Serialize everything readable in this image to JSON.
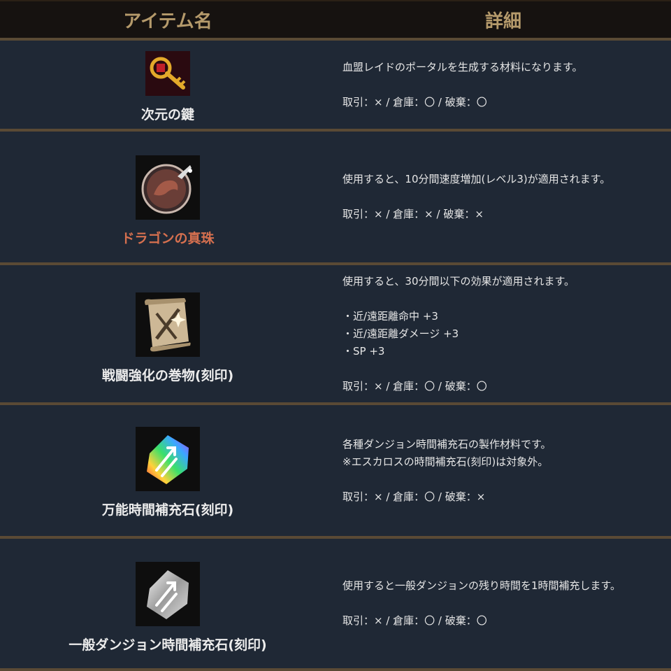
{
  "header": {
    "name_col": "アイテム名",
    "detail_col": "詳細"
  },
  "items": [
    {
      "name": "次元の鍵",
      "icon": "key-icon",
      "lines": [
        "血盟レイドのポータルを生成する材料になります。"
      ],
      "trade": "取引：× / 倉庫：〇 / 破棄：〇"
    },
    {
      "name": "ドラゴンの真珠",
      "icon": "dragon-pearl-icon",
      "name_color": "#d6704f",
      "lines": [
        "使用すると、10分間速度増加(レベル3)が適用されます。"
      ],
      "trade": "取引：× / 倉庫：× / 破棄：×"
    },
    {
      "name": "戦闘強化の巻物(刻印)",
      "icon": "scroll-icon",
      "lines": [
        "使用すると、30分間以下の効果が適用されます。"
      ],
      "effects": [
        "・近/遠距離命中 +3",
        "・近/遠距離ダメージ +3",
        "・SP +3"
      ],
      "trade": "取引：× / 倉庫：〇 / 破棄：〇"
    },
    {
      "name": "万能時間補充石(刻印)",
      "icon": "rainbow-crystal-icon",
      "lines": [
        "各種ダンジョン時間補充石の製作材料です。",
        "※エスカロスの時間補充石(刻印)は対象外。"
      ],
      "trade": "取引：× / 倉庫：〇 / 破棄：×"
    },
    {
      "name": "一般ダンジョン時間補充石(刻印)",
      "icon": "silver-crystal-icon",
      "lines": [
        "使用すると一般ダンジョンの残り時間を1時間補充します。"
      ],
      "trade": "取引：× / 倉庫：〇 / 破棄：〇"
    }
  ]
}
